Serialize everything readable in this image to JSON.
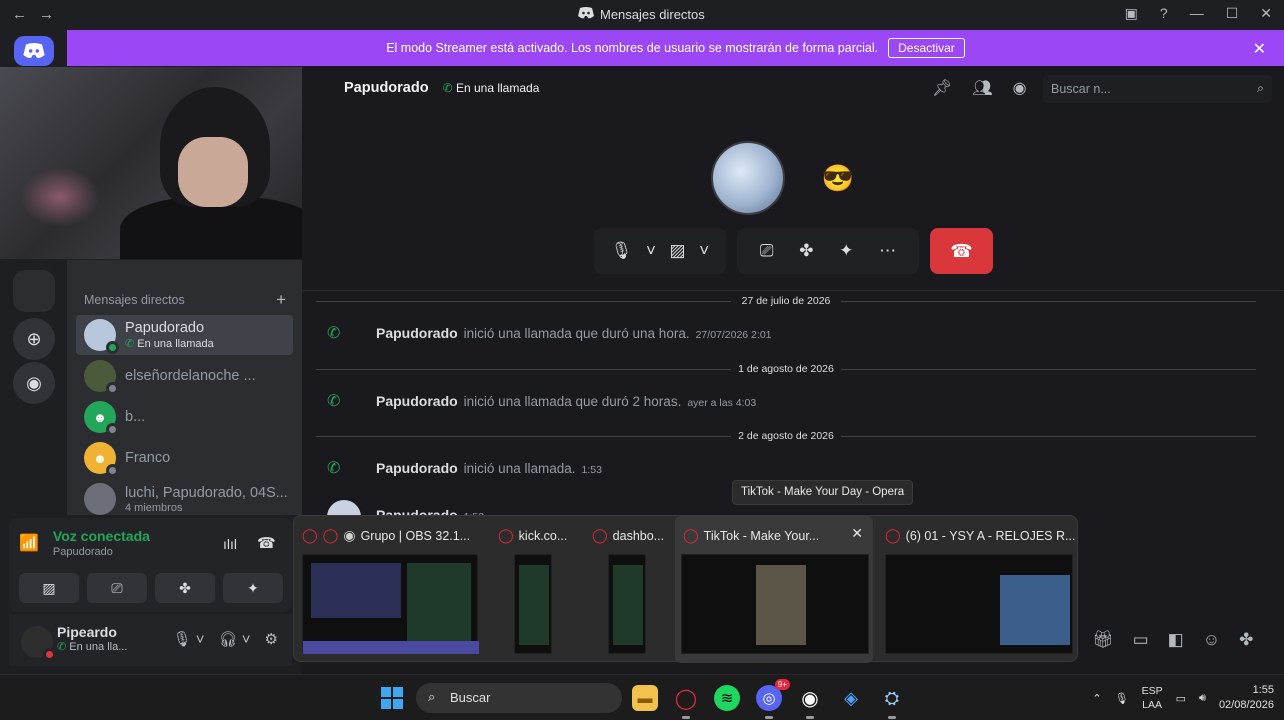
{
  "window": {
    "title": "Mensajes directos"
  },
  "banner": {
    "text": "El modo Streamer está activado. Los nombres de usuario se mostrarán de forma parcial.",
    "button": "Desactivar"
  },
  "channel": {
    "name": "Papudorado",
    "status": "En una llamada",
    "search_placeholder": "Buscar n..."
  },
  "sidebar": {
    "header": "Mensajes directos",
    "dms": [
      {
        "name": "Papudorado",
        "sub": "En una llamada",
        "active": true
      },
      {
        "name": "elseñordelanoche ...",
        "sub": ""
      },
      {
        "name": "b...",
        "sub": ""
      },
      {
        "name": "Franco",
        "sub": ""
      },
      {
        "name": "luchi, Papudorado, 04S...",
        "sub": "4 miembros"
      }
    ]
  },
  "voice": {
    "title": "Voz conectada",
    "channel": "Papudorado"
  },
  "user": {
    "name": "Pipeardo",
    "status": "En una lla..."
  },
  "messages": [
    {
      "date": "27 de julio de 2026",
      "author": "Papudorado",
      "text": "inició una llamada que duró una hora.",
      "ts": "27/07/2026 2:01"
    },
    {
      "date": "1 de agosto de 2026",
      "author": "Papudorado",
      "text": "inició una llamada que duró 2 horas.",
      "ts": "ayer a las 4:03"
    },
    {
      "date": "2 de agosto de 2026",
      "author": "Papudorado",
      "text": "inició una llamada.",
      "ts": "1:53"
    },
    {
      "date": "",
      "author": "Papudorado",
      "text": "",
      "ts": "1:53"
    }
  ],
  "tooltip": "TikTok - Make Your Day - Opera",
  "task_previews": [
    {
      "title": "Grupo | OBS 32.1..."
    },
    {
      "title": "kick.co..."
    },
    {
      "title": "dashbo..."
    },
    {
      "title": "TikTok - Make Your..."
    },
    {
      "title": "(6) 01 - YSY A - RELOJES R..."
    }
  ],
  "taskbar": {
    "search": "Buscar",
    "lang1": "ESP",
    "lang2": "LAA",
    "time": "1:55",
    "date": "02/08/2026",
    "badge": "9+"
  },
  "colors": {
    "accent": "#5865f2",
    "banner": "#9b47f5",
    "online": "#23a55a",
    "danger": "#da373c"
  }
}
